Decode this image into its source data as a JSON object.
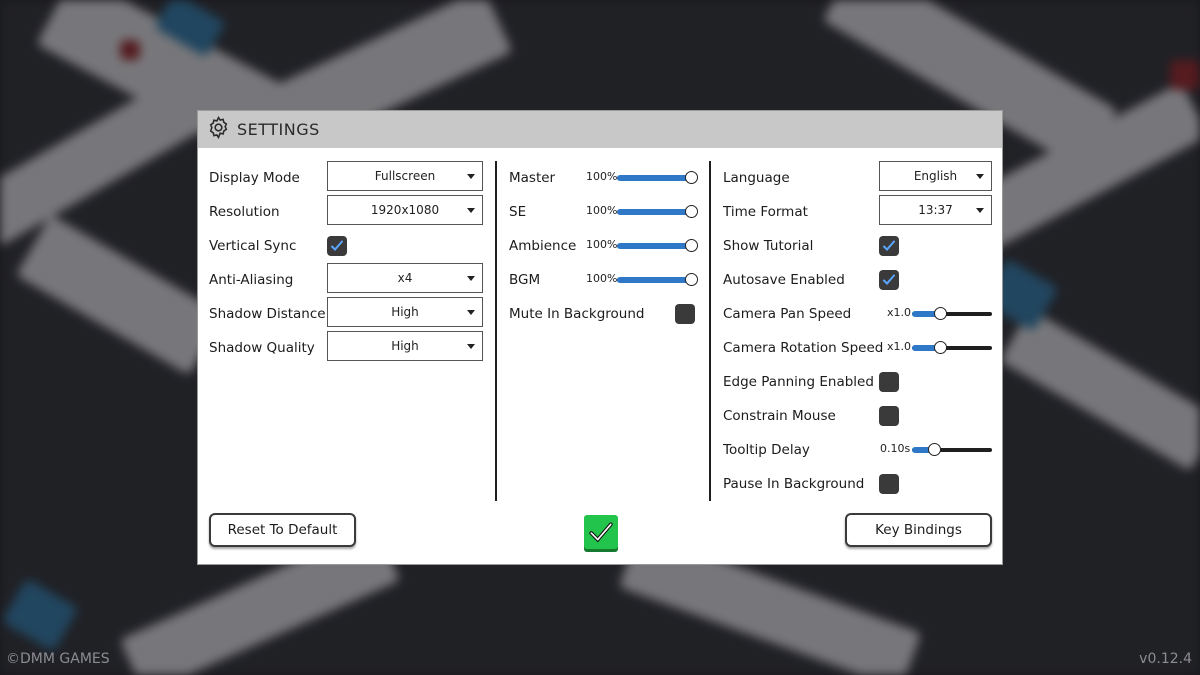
{
  "window": {
    "title": "SETTINGS"
  },
  "footer": {
    "copyright": "©DMM GAMES",
    "version": "v0.12.4"
  },
  "graphics": {
    "display_mode": {
      "label": "Display Mode",
      "value": "Fullscreen"
    },
    "resolution": {
      "label": "Resolution",
      "value": "1920x1080"
    },
    "vsync": {
      "label": "Vertical Sync",
      "checked": true
    },
    "anti_aliasing": {
      "label": "Anti-Aliasing",
      "value": "x4"
    },
    "shadow_distance": {
      "label": "Shadow Distance",
      "value": "High"
    },
    "shadow_quality": {
      "label": "Shadow Quality",
      "value": "High"
    }
  },
  "audio": {
    "master": {
      "label": "Master",
      "value": "100%",
      "level": 1.0
    },
    "se": {
      "label": "SE",
      "value": "100%",
      "level": 1.0
    },
    "ambience": {
      "label": "Ambience",
      "value": "100%",
      "level": 1.0
    },
    "bgm": {
      "label": "BGM",
      "value": "100%",
      "level": 1.0
    },
    "mute_bg": {
      "label": "Mute In Background",
      "checked": false
    }
  },
  "general": {
    "language": {
      "label": "Language",
      "value": "English"
    },
    "time_format": {
      "label": "Time Format",
      "value": "13:37"
    },
    "show_tutorial": {
      "label": "Show Tutorial",
      "checked": true
    },
    "autosave": {
      "label": "Autosave Enabled",
      "checked": true
    },
    "cam_pan": {
      "label": "Camera Pan Speed",
      "value": "x1.0",
      "level": 0.35
    },
    "cam_rot": {
      "label": "Camera Rotation Speed",
      "value": "x1.0",
      "level": 0.35
    },
    "edge_pan": {
      "label": "Edge Panning Enabled",
      "checked": false
    },
    "constrain_mouse": {
      "label": "Constrain Mouse",
      "checked": false
    },
    "tooltip_delay": {
      "label": "Tooltip Delay",
      "value": "0.10s",
      "level": 0.28
    },
    "pause_bg": {
      "label": "Pause In Background",
      "checked": false
    }
  },
  "buttons": {
    "reset": "Reset To Default",
    "key_bindings": "Key Bindings"
  },
  "colors": {
    "accent": "#2f78c8",
    "confirm": "#22c44b",
    "checkbox": "#3a3a3a"
  },
  "icons": {
    "title": "gear-icon",
    "check": "checkmark-icon",
    "dropdown": "chevron-down-icon"
  }
}
